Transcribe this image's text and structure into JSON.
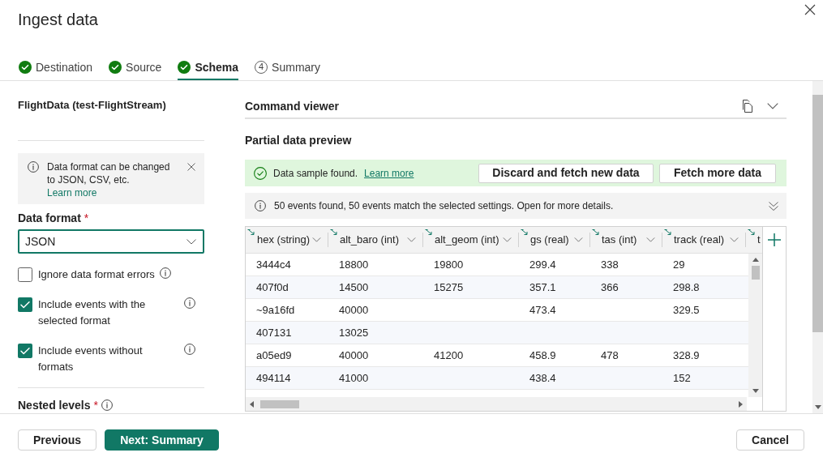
{
  "dialog": {
    "title": "Ingest data"
  },
  "steps": [
    {
      "label": "Destination",
      "kind": "done",
      "selected": false
    },
    {
      "label": "Source",
      "kind": "done",
      "selected": false
    },
    {
      "label": "Schema",
      "kind": "done",
      "selected": true
    },
    {
      "label": "Summary",
      "kind": "pending",
      "number": "4",
      "selected": false
    }
  ],
  "source": {
    "title": "FlightData (test-FlightStream)"
  },
  "info_message": {
    "text": "Data format can be changed to JSON, CSV, etc.",
    "link": "Learn more"
  },
  "data_format": {
    "label": "Data format",
    "required_mark": "*",
    "value": "JSON"
  },
  "options": [
    {
      "label": "Ignore data format errors",
      "checked": false
    },
    {
      "label": "Include events with the selected format",
      "checked": true
    },
    {
      "label": "Include events without formats",
      "checked": true
    }
  ],
  "nested_levels": {
    "label": "Nested levels",
    "required_mark": "*"
  },
  "command_viewer": {
    "title": "Command viewer"
  },
  "preview": {
    "title": "Partial data preview",
    "status": {
      "text": "Data sample found.",
      "link": "Learn more"
    },
    "actions": [
      "Discard and fetch new data",
      "Fetch more data"
    ],
    "summary": "50 events found, 50 events match the selected settings. Open for more details."
  },
  "table": {
    "columns": [
      "hex (string)",
      "alt_baro (int)",
      "alt_geom (int)",
      "gs (real)",
      "tas (int)",
      "track (real)",
      "t"
    ],
    "rows": [
      [
        "3444c4",
        "18800",
        "19800",
        "299.4",
        "338",
        "29"
      ],
      [
        "407f0d",
        "14500",
        "15275",
        "357.1",
        "366",
        "298.8"
      ],
      [
        "~9a16fd",
        "40000",
        null,
        "473.4",
        null,
        "329.5"
      ],
      [
        "407131",
        "13025",
        null,
        null,
        null,
        null
      ],
      [
        "a05ed9",
        "40000",
        "41200",
        "458.9",
        "478",
        "328.9"
      ],
      [
        "494114",
        "41000",
        null,
        "438.4",
        null,
        "152"
      ]
    ]
  },
  "footer": {
    "left_buttons": [
      {
        "label": "Previous",
        "kind": "secondary"
      },
      {
        "label": "Next: Summary",
        "kind": "primary"
      }
    ],
    "right_buttons": [
      {
        "label": "Cancel",
        "kind": "secondary"
      }
    ]
  }
}
